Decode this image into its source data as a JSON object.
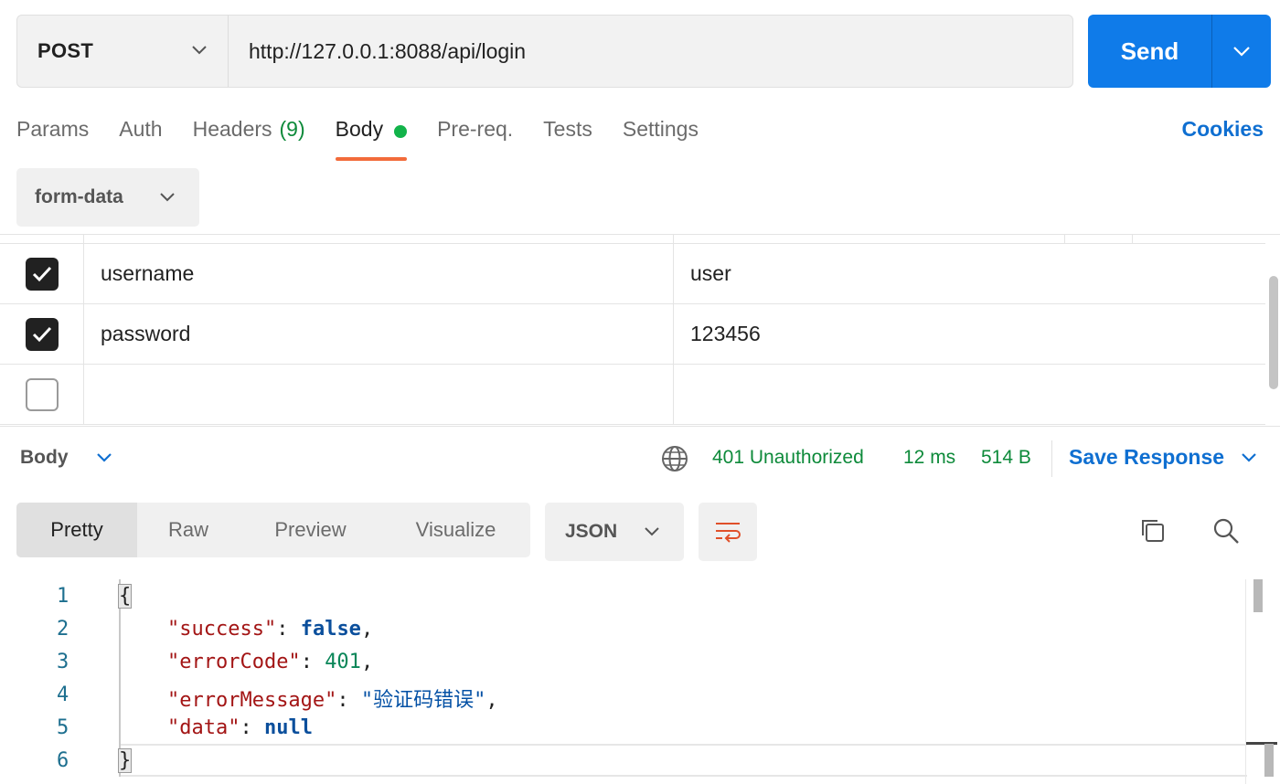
{
  "request": {
    "method": "POST",
    "url": "http://127.0.0.1:8088/api/login",
    "send_label": "Send"
  },
  "tabs": {
    "params": "Params",
    "auth": "Auth",
    "headers": "Headers",
    "headers_count": "(9)",
    "body": "Body",
    "prereq": "Pre-req.",
    "tests": "Tests",
    "settings": "Settings",
    "active": "Body"
  },
  "cookies_label": "Cookies",
  "body_type": "form-data",
  "form_rows": [
    {
      "checked": true,
      "key": "username",
      "value": "user"
    },
    {
      "checked": true,
      "key": "password",
      "value": "123456"
    },
    {
      "checked": false,
      "key": "",
      "value": ""
    }
  ],
  "response": {
    "section_label": "Body",
    "status": "401 Unauthorized",
    "time": "12 ms",
    "size": "514 B",
    "save_label": "Save Response",
    "view_tabs": [
      "Pretty",
      "Raw",
      "Preview",
      "Visualize"
    ],
    "active_view": "Pretty",
    "format": "JSON",
    "line_numbers": [
      "1",
      "2",
      "3",
      "4",
      "5",
      "6"
    ],
    "json": {
      "open": "{",
      "close": "}",
      "k_success": "\"success\"",
      "v_success": "false",
      "k_errorCode": "\"errorCode\"",
      "v_errorCode": "401",
      "k_errorMessage": "\"errorMessage\"",
      "v_errorMessage": "\"验证码错误\"",
      "k_data": "\"data\"",
      "v_data": "null"
    }
  },
  "colors": {
    "accent": "#0f7be9",
    "tab_underline": "#f26b3a",
    "status_green": "#0d8a3a",
    "link_blue": "#0f6fd1",
    "wrap_icon": "#e0502a"
  },
  "icons": [
    "chevron-down-icon",
    "globe-icon",
    "wrap-lines-icon",
    "copy-icon",
    "search-icon",
    "checkmark-icon"
  ]
}
